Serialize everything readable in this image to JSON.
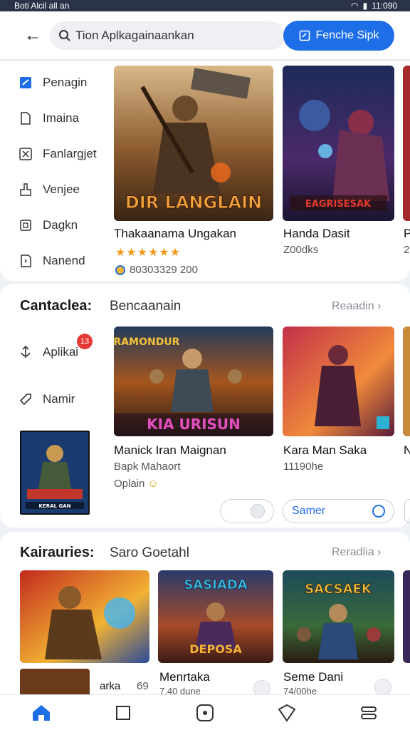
{
  "status": {
    "left": "Boti Alcil all an",
    "time": "11:090"
  },
  "topbar": {
    "back_icon": "arrow-left-icon",
    "search_text": "Tion Aplkagainaankan",
    "cta_label": "Fenche Sipk"
  },
  "sidebar": {
    "items": [
      {
        "label": "Penagin",
        "icon": "check-square-icon"
      },
      {
        "label": "Imaina",
        "icon": "document-icon"
      },
      {
        "label": "Fanlargjet",
        "icon": "x-box-icon"
      },
      {
        "label": "Venjee",
        "icon": "person-icon"
      },
      {
        "label": "Dagkn",
        "icon": "grid-icon"
      },
      {
        "label": "Nanend",
        "icon": "bookmark-icon"
      }
    ]
  },
  "featured": {
    "tiles": [
      {
        "art": "DIR LANGLAIN",
        "title": "Thakaanama Ungakan",
        "rating_stars": "★★★★★★",
        "sub": "80303329 200"
      },
      {
        "art": "EAGRISESAK",
        "title": "Handa Dasit",
        "sub": "Z00dks"
      },
      {
        "title": "P",
        "sub": "2"
      }
    ]
  },
  "section2": {
    "title": "Cantaclea:",
    "subtitle": "Bencaanain",
    "more": "Reaadin",
    "side_items": [
      {
        "label": "Aplikai",
        "badge": "13"
      },
      {
        "label": "Namir"
      }
    ],
    "thumb_art": "KERAL GAN",
    "tiles": [
      {
        "art_top": "RAMONDUR",
        "art": "KIA URISUN",
        "title": "Manick Iran Maignan",
        "sub": "Bapk Mahaort",
        "sub2": "Oplain"
      },
      {
        "title": "Kara Man Saka",
        "sub": "11190he"
      },
      {
        "title": "N"
      }
    ],
    "pills": [
      {
        "label": ""
      },
      {
        "label": "Samer"
      }
    ]
  },
  "section3": {
    "title": "Kairauries:",
    "subtitle": "Saro Goetahl",
    "more": "Reradlia",
    "tiles": [
      {
        "art": "",
        "title": "arka",
        "sub": "69"
      },
      {
        "art": "SASIADA",
        "art2": "DEPOSA",
        "title": "Menrtaka",
        "sub": "7.40 dune"
      },
      {
        "art": "SACSAEK",
        "title": "Seme Dani",
        "sub": "74/00he"
      }
    ]
  },
  "nav": {
    "items": [
      "home-icon",
      "square-icon",
      "circle-icon",
      "shield-icon",
      "menu-icon"
    ]
  },
  "colors": {
    "accent": "#1e6ee8",
    "badge": "#e53935",
    "star": "#f29a1f"
  }
}
